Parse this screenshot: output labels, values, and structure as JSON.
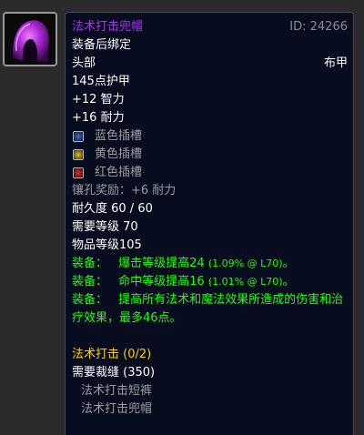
{
  "item": {
    "name": "法术打击兜帽",
    "id": "ID: 24266",
    "binding": "装备后绑定",
    "slot": "头部",
    "armor_type": "布甲",
    "armor": "145点护甲",
    "stats": [
      "+12 智力",
      "+16 耐力"
    ],
    "sockets": [
      {
        "color": "blue",
        "label": "蓝色插槽"
      },
      {
        "color": "yellow",
        "label": "黄色插槽"
      },
      {
        "color": "red",
        "label": "红色插槽"
      }
    ],
    "socket_bonus": "镶孔奖励：+6 耐力",
    "durability": "耐久度 60 / 60",
    "required_level": "需要等级 70",
    "item_level": "物品等级105",
    "equip_effects": [
      {
        "prefix": "装备：",
        "text": "爆击等级提高24",
        "note": "(1.09% @ L70)",
        "suffix": "。"
      },
      {
        "prefix": "装备：",
        "text": "命中等级提高16",
        "note": "(1.01% @ L70)",
        "suffix": "。"
      },
      {
        "prefix": "装备：",
        "text": "提高所有法术和魔法效果所造成的伤害和治疗效果，最多46点。",
        "note": "",
        "suffix": ""
      }
    ],
    "set": {
      "name": "法术打击  (0/2)",
      "requirement": "需要裁缝 (350)",
      "pieces": [
        "法术打击短裤",
        "法术打击兜帽"
      ]
    }
  },
  "icon": "purple-hood-icon",
  "colors": {
    "epic": "#a335ee",
    "uncommon_green": "#1eff00",
    "set_gold": "#ffd100",
    "grey": "#9d9d9d"
  }
}
